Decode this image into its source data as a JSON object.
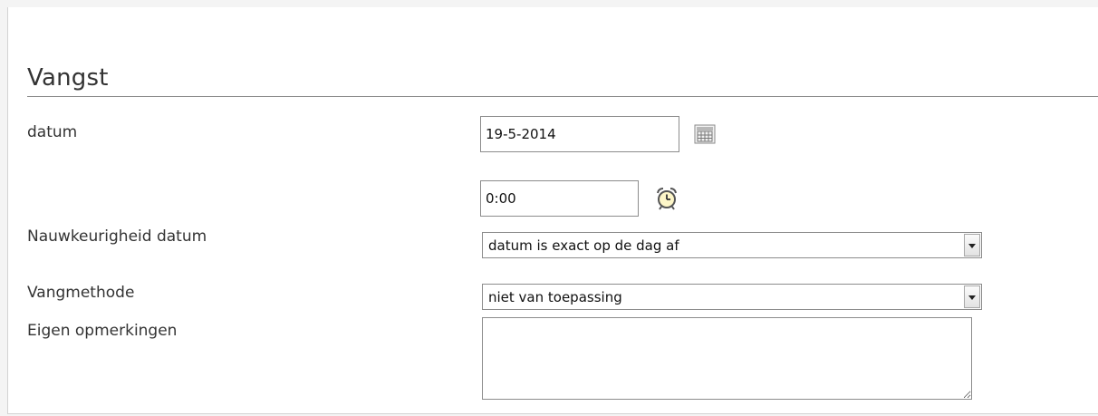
{
  "section": {
    "title": "Vangst"
  },
  "fields": {
    "datum": {
      "label": "datum",
      "value": "19-5-2014",
      "calendar_icon": "calendar-icon"
    },
    "tijd": {
      "value": "0:00",
      "clock_icon": "alarm-clock-icon"
    },
    "nauwkeurigheid": {
      "label": "Nauwkeurigheid datum",
      "selected": "datum is exact op de dag af"
    },
    "vangmethode": {
      "label": "Vangmethode",
      "selected": "niet van toepassing"
    },
    "opmerkingen": {
      "label": "Eigen opmerkingen",
      "value": ""
    }
  }
}
